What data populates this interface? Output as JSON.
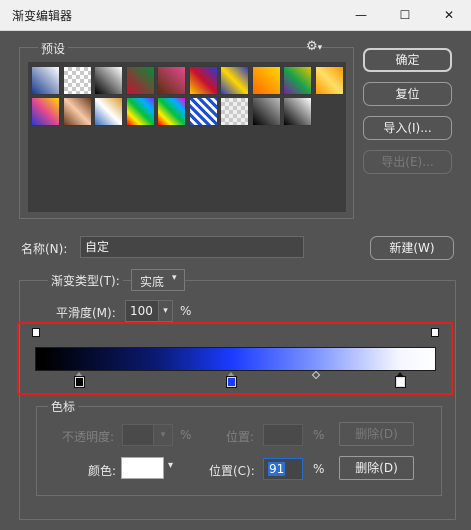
{
  "window": {
    "title": "渐变编辑器",
    "controls": {
      "minimize": "—",
      "maximize": "☐",
      "close": "✕"
    }
  },
  "presets": {
    "legend": "预设",
    "gear_glyph": "⚙",
    "swatches": [
      "linear-gradient(45deg,#1b3c8c,#fff)",
      "repeating-conic-gradient(#c9c9c9 0 25%,#fff 0 50%) 0 0/8px 8px",
      "linear-gradient(45deg,#000,#fff)",
      "linear-gradient(45deg,#c8102e,#0a8a3d)",
      "linear-gradient(45deg,#5a2e0c,#e34a8e)",
      "linear-gradient(45deg,#ffcc00,#c8102e,#2a3bd0)",
      "linear-gradient(45deg,#2a3bd0,#ffd700,#2a3bd0)",
      "linear-gradient(45deg,#ff6a00,#ffd700)",
      "linear-gradient(45deg,#7a1fa2,#1aa34a,#e8c200)",
      "linear-gradient(45deg,#ff9500,#ffe066,#ff9500)",
      "linear-gradient(45deg,#2a3bd0,#e34a8e,#ffd700)",
      "linear-gradient(45deg,#6b3a1d,#f6c9a8,#6b3a1d)",
      "linear-gradient(45deg,#3c6fbf,#fff,#d99b2e)",
      "linear-gradient(45deg,#ff0000,#ffee00,#00c040,#00b0ff,#7b2cff)",
      "linear-gradient(45deg,#ff0000,#ffee00,#00c040,#00b0ff,#ff00cc)",
      "repeating-linear-gradient(45deg,#1a4fd0 0 3px,#fff 3px 6px)",
      "repeating-conic-gradient(#c9c9c9 0 25%,#efefef 0 50%) 0 0/8px 8px",
      "linear-gradient(45deg,#000,#bdbdbd)",
      "linear-gradient(45deg,#000,#fff)"
    ]
  },
  "buttons": {
    "ok": "确定",
    "reset": "复位",
    "import": "导入(I)...",
    "export": "导出(E)...",
    "new": "新建(W)",
    "delete_opacity": "删除(D)",
    "delete_color": "删除(D)"
  },
  "name_field": {
    "label": "名称(N):",
    "value": "自定"
  },
  "gradient_type": {
    "label": "渐变类型(T):",
    "value": "实底"
  },
  "smoothness": {
    "label": "平滑度(M):",
    "value": "100",
    "unit": "%"
  },
  "gradient_bar": {
    "css": "linear-gradient(to right,#000 0%,#000 2%,#0a1a70 30%,#1a3bff 49%,#7d95ff 70%,#f5f7ff 91%,#fff 100%)",
    "opacity_stops": [
      0,
      100
    ],
    "color_stops": [
      {
        "pos": 11,
        "color": "#000000"
      },
      {
        "pos": 49,
        "color": "#1a3bff"
      },
      {
        "pos": 91,
        "color": "#ffffff"
      }
    ],
    "midpoint": 70
  },
  "stops_section": {
    "legend": "色标",
    "opacity_label": "不透明度:",
    "opacity_unit": "%",
    "opacity_position_label": "位置:",
    "opacity_position_unit": "%",
    "color_label": "颜色:",
    "color_value": "#ffffff",
    "color_position_label": "位置(C):",
    "color_position_value": "91",
    "color_position_unit": "%"
  }
}
